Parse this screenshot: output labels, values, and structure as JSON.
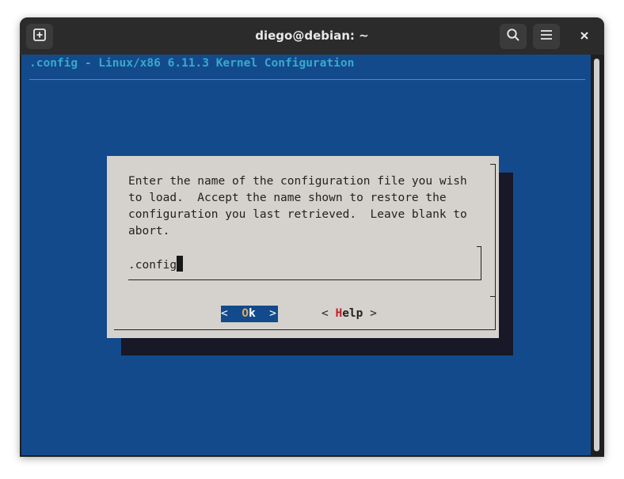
{
  "window": {
    "title": "diego@debian: ~"
  },
  "terminal": {
    "header": ".config - Linux/x86 6.11.3 Kernel Configuration",
    "dialog": {
      "message": "Enter the name of the configuration file you wish\nto load.  Accept the name shown to restore the\nconfiguration you last retrieved.  Leave blank to\nabort.",
      "input_value": ".config",
      "ok": {
        "left": "<",
        "hotkey": "O",
        "rest": "k",
        "right": ">"
      },
      "help": {
        "left": "<",
        "hotkey": "H",
        "rest": "elp",
        "right": ">"
      }
    }
  },
  "icons": {
    "new_tab": "new-tab-icon",
    "search": "search-icon",
    "menu": "hamburger-menu-icon",
    "close": "close-icon"
  },
  "colors": {
    "terminal_bg": "#134a8c",
    "dialog_bg": "#d5d2cd",
    "header_text": "#39a9c9",
    "hotkey_ok": "#e6a65a",
    "hotkey_help": "#c2202a"
  }
}
